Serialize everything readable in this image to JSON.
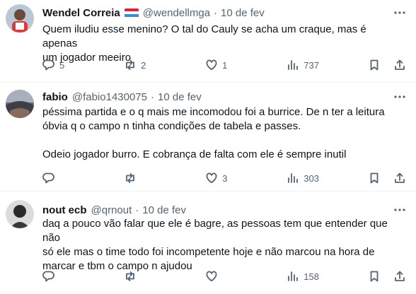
{
  "tweets": [
    {
      "name": "Wendel Correia",
      "handle": "@wendellmga",
      "separator": "·",
      "date": "10 de fev",
      "text": "Quem iludiu esse menino? O tal do Cauly se acha um craque, mas é apenas\num jogador meeiro",
      "replies": "5",
      "reposts": "2",
      "likes": "1",
      "views": "737"
    },
    {
      "name": "fabio",
      "handle": "@fabio1430075",
      "separator": "·",
      "date": "10 de fev",
      "text": "péssima partida e o q mais me incomodou foi a burrice. De n ter a leitura\nóbvia q o campo n tinha condições de tabela e passes.\n\nOdeio jogador burro. E cobrança de falta com ele é sempre inutil",
      "replies": "",
      "reposts": "",
      "likes": "3",
      "views": "303"
    },
    {
      "name": "nout ecb",
      "handle": "@qrnout",
      "separator": "·",
      "date": "10 de fev",
      "text": "daq a pouco vão falar que ele é bagre, as pessoas tem que entender que não\nsó ele mas o time todo foi incompetente hoje e não marcou na hora de\nmarcar e tbm o campo n ajudou",
      "replies": "",
      "reposts": "",
      "likes": "",
      "views": "158"
    }
  ],
  "icons": {
    "reply": "reply-icon",
    "repost": "repost-icon",
    "like": "heart-icon",
    "views": "views-icon",
    "bookmark": "bookmark-icon",
    "share": "share-icon",
    "more": "more-icon"
  },
  "colors": {
    "text": "#0f1419",
    "secondary": "#536471",
    "divider": "#eff3f4",
    "flag_red": "#e0203a",
    "flag_white": "#ffffff",
    "flag_blue": "#3a8bd9"
  }
}
